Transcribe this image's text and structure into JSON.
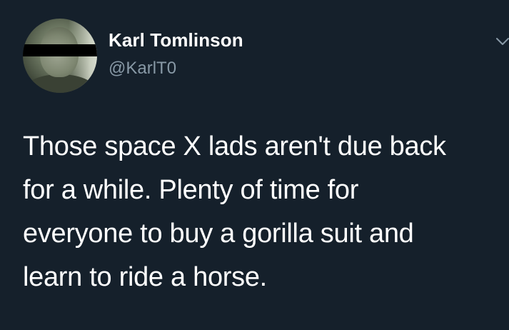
{
  "author": {
    "display_name": "Karl Tomlinson",
    "handle": "@KarlT0"
  },
  "tweet": {
    "text": "Those space X lads aren't due back\nfor a while. Plenty of time for\neveryone to buy a gorilla suit and\nlearn to ride a horse."
  },
  "icons": {
    "menu": "chevron-down-icon"
  },
  "colors": {
    "background": "#15202b",
    "primary_text": "#ffffff",
    "secondary_text": "#8899a6"
  }
}
